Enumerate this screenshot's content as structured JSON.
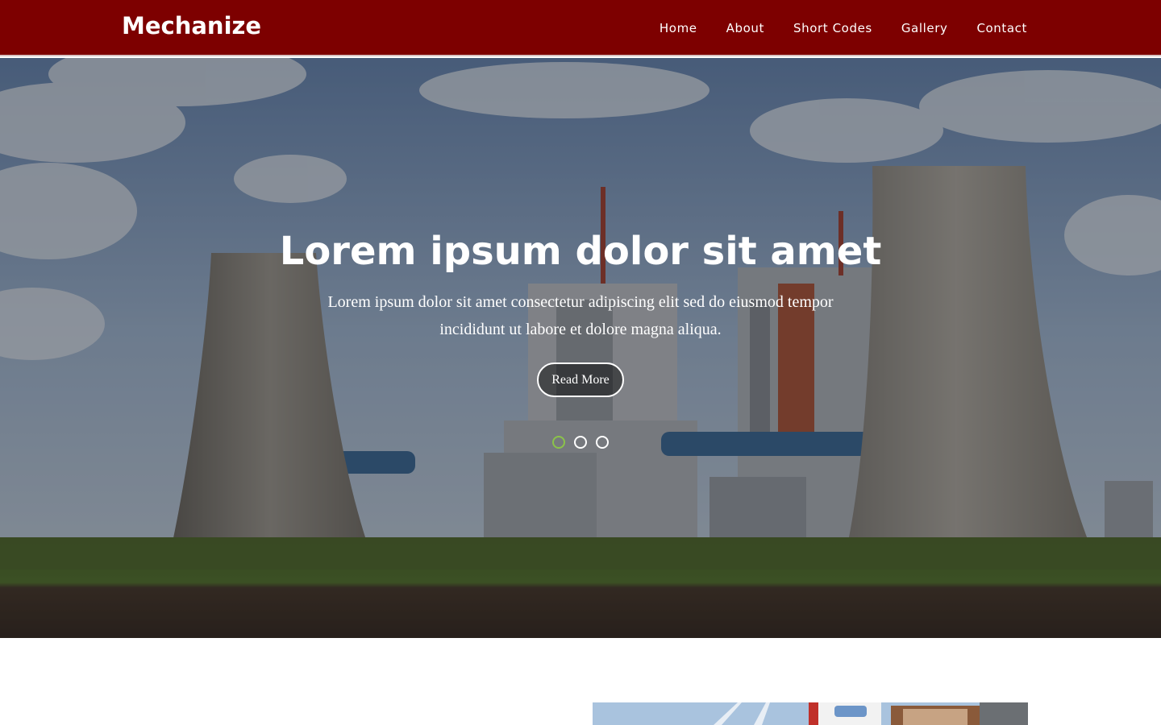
{
  "header": {
    "logo": "Mechanize",
    "nav": [
      {
        "label": "Home"
      },
      {
        "label": "About"
      },
      {
        "label": "Short Codes"
      },
      {
        "label": "Gallery"
      },
      {
        "label": "Contact"
      }
    ],
    "background_color": "#7d0000"
  },
  "hero": {
    "title": "Lorem ipsum dolor sit amet",
    "text": "Lorem ipsum dolor sit amet consectetur adipiscing elit sed do eiusmod tempor incididunt ut labore et dolore magna aliqua.",
    "button_label": "Read More",
    "slides": [
      {
        "active": true
      },
      {
        "active": false
      },
      {
        "active": false
      }
    ],
    "active_dot_color": "#8bc34a"
  }
}
